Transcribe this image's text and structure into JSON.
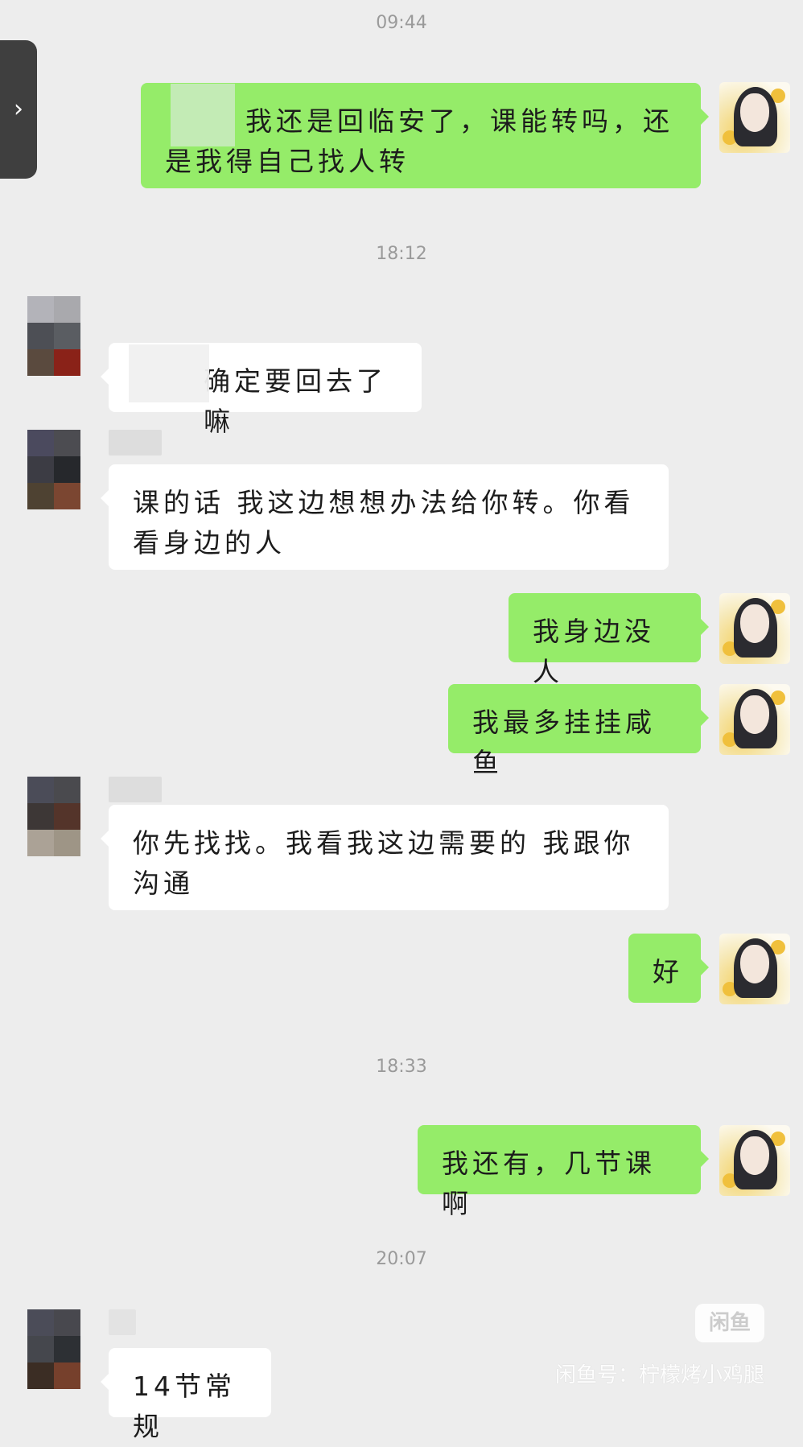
{
  "timestamps": [
    "09:44",
    "18:12",
    "18:33",
    "20:07"
  ],
  "messages": [
    {
      "side": "me",
      "text": "我还是回临安了，课能转吗，还是我得自己找人转"
    },
    {
      "side": "them",
      "text": "确定要回去了嘛"
    },
    {
      "side": "them",
      "text": "课的话 我这边想想办法给你转。你看看身边的人"
    },
    {
      "side": "me",
      "text": "我身边没人"
    },
    {
      "side": "me",
      "text": "我最多挂挂咸鱼"
    },
    {
      "side": "them",
      "text": "你先找找。我看我这边需要的 我跟你沟通"
    },
    {
      "side": "me",
      "text": "好"
    },
    {
      "side": "me",
      "text": "我还有，几节课啊"
    },
    {
      "side": "them",
      "text": "14节常规"
    }
  ],
  "icons": {
    "side_tab": "chevron-right-icon"
  },
  "watermark": {
    "logo": "闲鱼",
    "text": "闲鱼号：柠檬烤小鸡腿"
  },
  "colors": {
    "background": "#ededed",
    "my_bubble": "#95ec69",
    "their_bubble": "#ffffff",
    "timestamp": "#9a9a9a"
  }
}
